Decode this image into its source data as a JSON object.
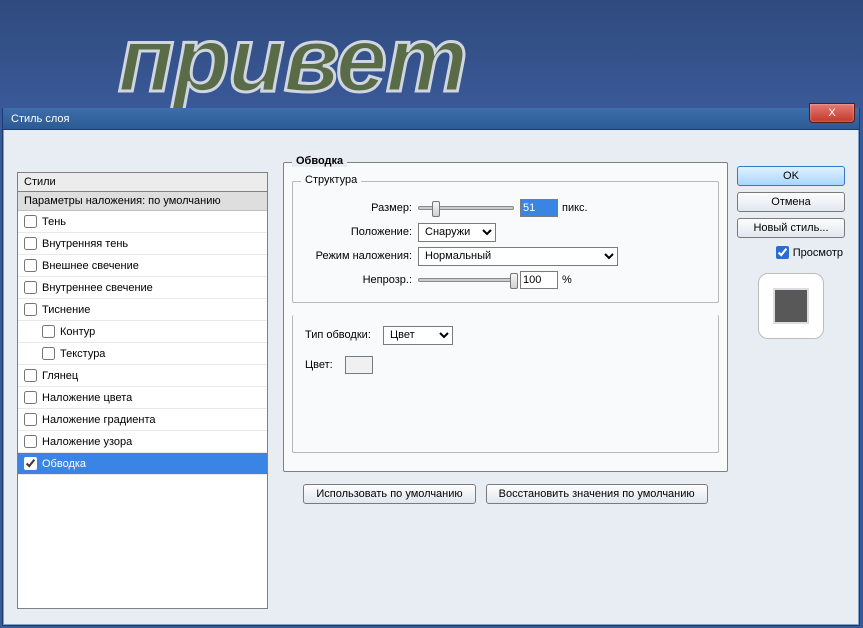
{
  "canvas_text": "привет",
  "dialog_title": "Стиль слоя",
  "close_x": "X",
  "styles_header": "Стили",
  "styles_subheader": "Параметры наложения: по умолчанию",
  "style_items": [
    {
      "label": "Тень",
      "checked": false,
      "indent": false
    },
    {
      "label": "Внутренняя тень",
      "checked": false,
      "indent": false
    },
    {
      "label": "Внешнее свечение",
      "checked": false,
      "indent": false
    },
    {
      "label": "Внутреннее свечение",
      "checked": false,
      "indent": false
    },
    {
      "label": "Тиснение",
      "checked": false,
      "indent": false
    },
    {
      "label": "Контур",
      "checked": false,
      "indent": true
    },
    {
      "label": "Текстура",
      "checked": false,
      "indent": true
    },
    {
      "label": "Глянец",
      "checked": false,
      "indent": false
    },
    {
      "label": "Наложение цвета",
      "checked": false,
      "indent": false
    },
    {
      "label": "Наложение градиента",
      "checked": false,
      "indent": false
    },
    {
      "label": "Наложение узора",
      "checked": false,
      "indent": false
    },
    {
      "label": "Обводка",
      "checked": true,
      "indent": false,
      "selected": true
    }
  ],
  "panel": {
    "title": "Обводка",
    "structure_title": "Структура",
    "size_label": "Размер:",
    "size_value": "51",
    "size_unit": "пикс.",
    "size_thumb_percent": 14,
    "position_label": "Положение:",
    "position_value": "Снаружи",
    "blend_label": "Режим наложения:",
    "blend_value": "Нормальный",
    "opacity_label": "Непрозр.:",
    "opacity_value": "100",
    "opacity_unit": "%",
    "opacity_thumb_percent": 97,
    "filltype_label": "Тип обводки:",
    "filltype_value": "Цвет",
    "color_label": "Цвет:",
    "use_default": "Использовать по умолчанию",
    "restore_default": "Восстановить значения по умолчанию"
  },
  "right": {
    "ok": "OK",
    "cancel": "Отмена",
    "new_style": "Новый стиль...",
    "preview_label": "Просмотр"
  }
}
